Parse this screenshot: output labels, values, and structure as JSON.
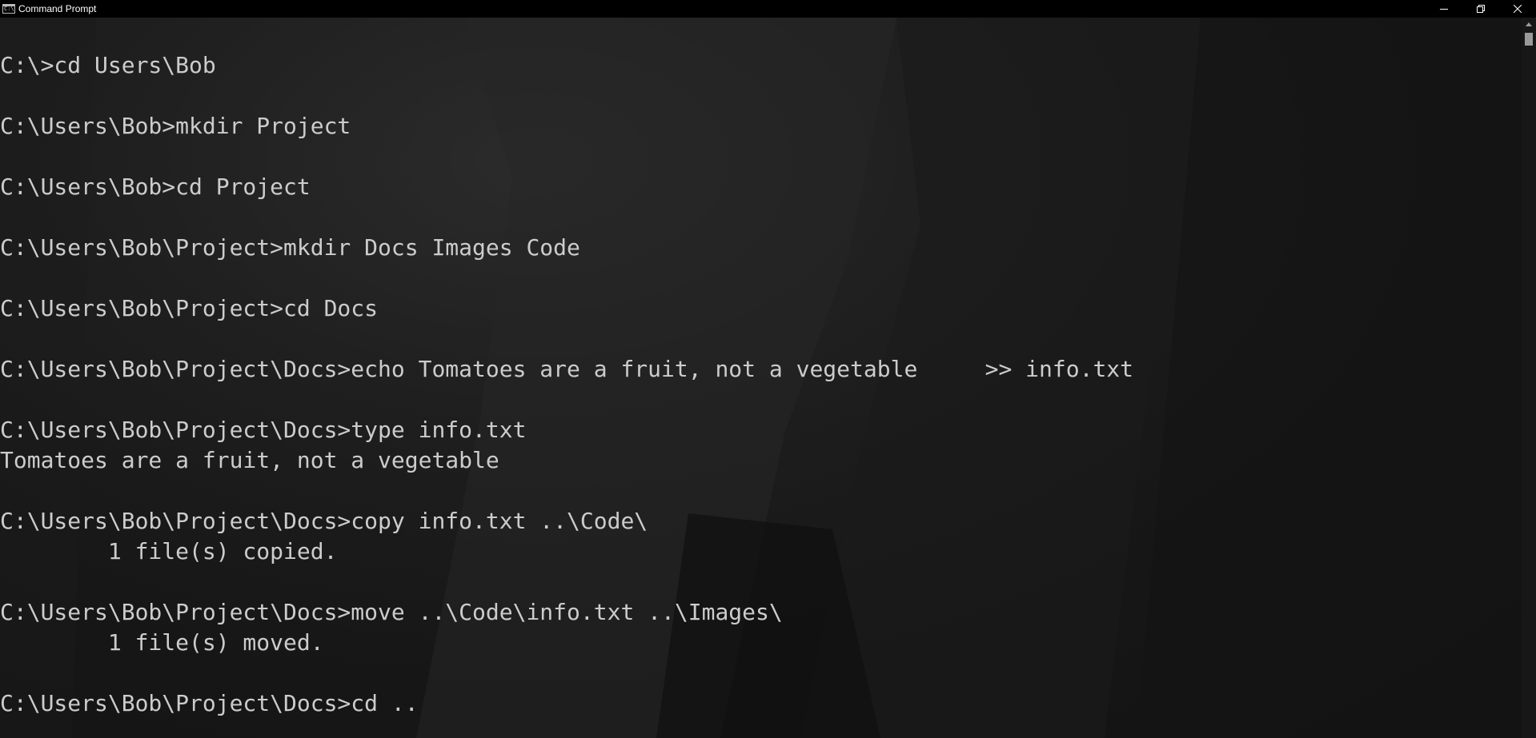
{
  "window": {
    "title": "Command Prompt",
    "icon": "cmd-app-icon",
    "controls": [
      "minimize-icon",
      "restore-icon",
      "close-icon"
    ]
  },
  "console": {
    "lines": [
      "C:\\>cd Users\\Bob",
      "",
      "C:\\Users\\Bob>mkdir Project",
      "",
      "C:\\Users\\Bob>cd Project",
      "",
      "C:\\Users\\Bob\\Project>mkdir Docs Images Code",
      "",
      "C:\\Users\\Bob\\Project>cd Docs",
      "",
      "C:\\Users\\Bob\\Project\\Docs>echo Tomatoes are a fruit, not a vegetable     >> info.txt",
      "",
      "C:\\Users\\Bob\\Project\\Docs>type info.txt",
      "Tomatoes are a fruit, not a vegetable",
      "",
      "C:\\Users\\Bob\\Project\\Docs>copy info.txt ..\\Code\\",
      "        1 file(s) copied.",
      "",
      "C:\\Users\\Bob\\Project\\Docs>move ..\\Code\\info.txt ..\\Images\\",
      "        1 file(s) moved.",
      "",
      "C:\\Users\\Bob\\Project\\Docs>cd .."
    ]
  },
  "colors": {
    "titlebar_bg": "#000000",
    "console_text": "#cccccc",
    "console_bg": "#1c1c1c"
  }
}
